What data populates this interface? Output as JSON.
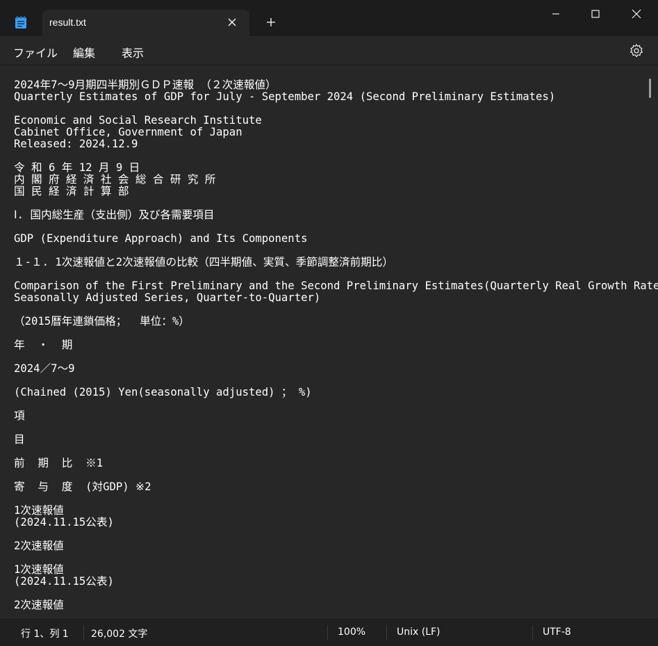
{
  "window": {
    "tab_title": "result.txt",
    "app_icon": "notepad-icon"
  },
  "menu": {
    "file": "ファイル",
    "edit": "編集",
    "view": "表示"
  },
  "content": {
    "lines": [
      "2024年7～9月期四半期別ＧＤＰ速報 （２次速報値）",
      "Quarterly Estimates of GDP for July - September 2024 (Second Preliminary Estimates)",
      "",
      "Economic and Social Research Institute",
      "Cabinet Office, Government of Japan",
      "Released: 2024.12.9",
      "",
      "令 和 6 年 12 月 9 日",
      "内 閣 府 経 済 社 会 総 合 研 究 所",
      "国 民 経 済 計 算 部",
      "",
      "Ⅰ. 国内総生産（支出側）及び各需要項目",
      "",
      "GDP (Expenditure Approach) and Its Components",
      "",
      "１-１. 1次速報値と2次速報値の比較（四半期値、実質、季節調整済前期比）",
      "",
      "Comparison of the First Preliminary and the Second Preliminary Estimates(Quarterly Real Growth Rate,",
      "Seasonally Adjusted Series, Quarter-to-Quarter)",
      "",
      "（2015暦年連鎖価格；  単位：%）",
      "",
      "年  ・  期",
      "",
      "2024／7～9",
      "",
      "(Chained (2015) Yen(seasonally adjusted) ； %)",
      "",
      "項",
      "",
      "目",
      "",
      "前  期  比  ※1",
      "",
      "寄  与  度  (対GDP) ※2",
      "",
      "1次速報値",
      "(2024.11.15公表)",
      "",
      "2次速報値",
      "",
      "1次速報値",
      "(2024.11.15公表)",
      "",
      "2次速報値"
    ]
  },
  "status": {
    "position": "行 1、列 1",
    "char_count": "26,002 文字",
    "zoom": "100%",
    "line_ending": "Unix (LF)",
    "encoding": "UTF-8"
  }
}
